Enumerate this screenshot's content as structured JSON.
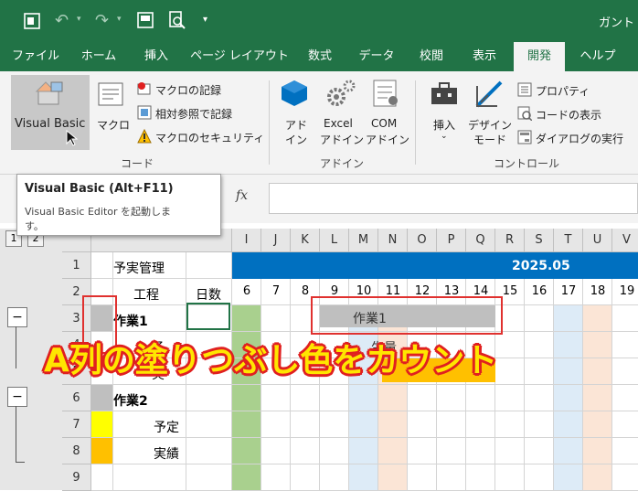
{
  "title": {
    "text": "ガント"
  },
  "tabs": [
    {
      "label": "ファイル"
    },
    {
      "label": "ホーム"
    },
    {
      "label": "挿入"
    },
    {
      "label": "ページ レイアウト"
    },
    {
      "label": "数式"
    },
    {
      "label": "データ"
    },
    {
      "label": "校閲"
    },
    {
      "label": "表示"
    },
    {
      "label": "開発"
    },
    {
      "label": "ヘルプ"
    }
  ],
  "ribbon": {
    "code": {
      "visual_basic": "Visual Basic",
      "macro": "マクロ",
      "record_macro": "マクロの記録",
      "relative_ref": "相対参照で記録",
      "macro_security": "マクロのセキュリティ",
      "group_label": "コード"
    },
    "addins": {
      "addin_l1": "アド",
      "addin_l2": "イン",
      "excel_addin_l1": "Excel",
      "excel_addin_l2": "アドイン",
      "com_addin_l1": "COM",
      "com_addin_l2": "アドイン",
      "group_label": "アドイン"
    },
    "controls": {
      "insert": "挿入",
      "design_l1": "デザイン",
      "design_l2": "モード",
      "properties": "プロパティ",
      "view_code": "コードの表示",
      "run_dialog": "ダイアログの実行",
      "group_label": "コントロール"
    }
  },
  "formula_bar": {
    "fx": "fx"
  },
  "tooltip": {
    "title": "Visual Basic (Alt+F11)",
    "desc_l1": "Visual Basic Editor を起動しま",
    "desc_l2": "す。"
  },
  "outline": {
    "level1": "1",
    "level2": "2",
    "minus": "−"
  },
  "columns": [
    "I",
    "J",
    "K",
    "L",
    "M",
    "N",
    "O",
    "P",
    "Q",
    "R",
    "S",
    "T",
    "U",
    "V"
  ],
  "rows": [
    "1",
    "2",
    "3",
    "4",
    "5",
    "6",
    "7",
    "8",
    "9"
  ],
  "cells": {
    "b1": "予実管理",
    "b2": "工程",
    "c2": "日数",
    "b3": "作業1",
    "b4_partial": "予",
    "b5_partial": "実",
    "b6": "作業2",
    "b7": "予定",
    "b8": "実績",
    "banner_date": "2025.05",
    "days": [
      "6",
      "7",
      "8",
      "9",
      "10",
      "11",
      "12",
      "13",
      "14",
      "15",
      "16",
      "17",
      "18",
      "19"
    ],
    "bar_label": "作業1",
    "bar_partial": "生量"
  },
  "overlay": {
    "caption": "A列の塗りつぶし色をカウント"
  },
  "colors": {
    "excel_green": "#217346",
    "header_blue": "#0070c0",
    "yellow": "#ffff00",
    "orange": "#ffc000",
    "gray_bar": "#bfbfbf",
    "weekend_blue": "#ddebf7",
    "weekend_pink": "#fbe5d6",
    "today_green": "#a9d08e",
    "annotation_red": "#e0312f"
  },
  "icons": [
    "excel-logo-icon",
    "undo-icon",
    "redo-icon",
    "form-icon",
    "print-preview-icon",
    "visual-basic-icon",
    "macro-icon",
    "record-icon",
    "relative-ref-icon",
    "security-warning-icon",
    "addin-cube-icon",
    "gear-icon",
    "com-addin-icon",
    "toolbox-icon",
    "design-mode-icon",
    "properties-icon",
    "view-code-icon",
    "dialog-icon",
    "cursor-icon"
  ]
}
